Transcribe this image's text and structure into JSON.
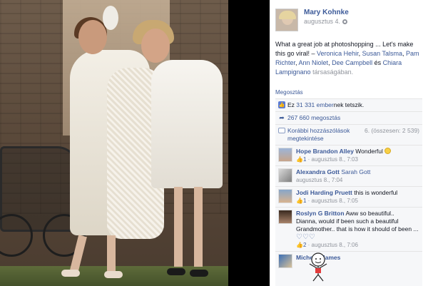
{
  "post": {
    "author_name": "Mary Kohnke",
    "date": "augusztus 4.",
    "text_main": "What a great job at photoshopping ... Let's make this go viral!",
    "tags": [
      "Veronica Hehir",
      "Susan Talsma",
      "Pam Richter",
      "Ann Niolet",
      "Dee Campbell"
    ],
    "tag_sep": ", ",
    "tag_and": " és ",
    "tag_last": "Chiara Lampignano",
    "tag_suffix": "társaságában.",
    "dash": " – "
  },
  "actions": {
    "share_label": "Megosztás"
  },
  "stats": {
    "likes_count": "31 331 ember",
    "likes_text_prefix": "Ez ",
    "likes_text_suffix": "nek tetszik.",
    "shares": "267 660 megosztás",
    "previous_comments": "Korábbi hozzászólások megtekintése",
    "comment_position": "6. (összesen: 2 539)"
  },
  "comments": [
    {
      "name": "Hope Brandon Alley",
      "text": "Wonderful",
      "has_smile": true,
      "likes": "1",
      "date": "augusztus 8., 7:03",
      "has_like": true
    },
    {
      "name": "Alexandra Gott",
      "text": "Sarah Gott",
      "text_is_link": true,
      "likes": "",
      "date": "augusztus 8., 7:04",
      "has_like": false
    },
    {
      "name": "Jodi Harding Pruett",
      "text": "this is wonderful",
      "likes": "1",
      "date": "augusztus 8., 7:05",
      "has_like": true
    },
    {
      "name": "Roslyn G Britton",
      "text": "Aww so beautiful..",
      "text2": "Dianna, would if been such a beautiful Grandmother.. that is how it should of been ...",
      "hearts": "♡♡♡",
      "likes": "2",
      "date": "augusztus 8., 7:06",
      "has_like": true
    },
    {
      "name": "Michelle James",
      "text": "",
      "likes": "",
      "date": "",
      "has_like": false
    }
  ],
  "icons": {
    "settings": "gear-icon",
    "like": "thumbs-up-icon",
    "share": "share-arrow-icon",
    "comment": "speech-bubble-icon"
  },
  "colors": {
    "link": "#3b5998",
    "meta": "#90949c",
    "panel_bg": "#f6f7f9"
  }
}
